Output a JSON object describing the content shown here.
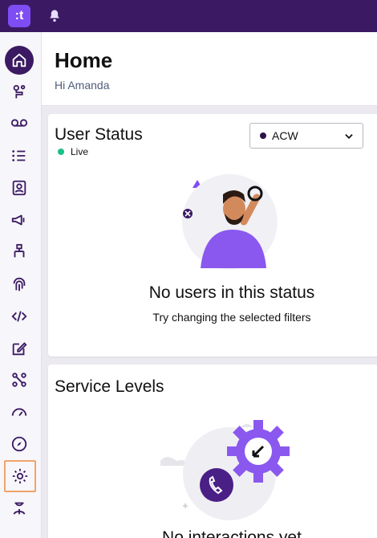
{
  "topbar": {
    "logo_text": ":t",
    "bell_icon": "bell-icon"
  },
  "sidebar": {
    "items": [
      {
        "name": "home-icon",
        "active": true
      },
      {
        "name": "routing-icon"
      },
      {
        "name": "voicemail-icon"
      },
      {
        "name": "list-icon"
      },
      {
        "name": "contacts-icon"
      },
      {
        "name": "megaphone-icon"
      },
      {
        "name": "flow-icon"
      },
      {
        "name": "fingerprint-icon"
      },
      {
        "name": "code-icon"
      },
      {
        "name": "edit-icon"
      },
      {
        "name": "integrations-icon"
      },
      {
        "name": "speedometer-icon"
      },
      {
        "name": "compass-icon"
      },
      {
        "name": "gear-icon"
      },
      {
        "name": "agent-icon"
      }
    ]
  },
  "header": {
    "title": "Home",
    "greeting": "Hi Amanda"
  },
  "user_status": {
    "title": "User Status",
    "live_label": "Live",
    "dropdown_value": "ACW",
    "empty_title": "No users in this status",
    "empty_subtitle": "Try changing the selected filters"
  },
  "service_levels": {
    "title": "Service Levels",
    "empty_title": "No interactions yet"
  },
  "colors": {
    "brand": "#3b1a63",
    "accent": "#7f4df3",
    "live": "#18c08a",
    "highlight": "#f0a36a"
  }
}
